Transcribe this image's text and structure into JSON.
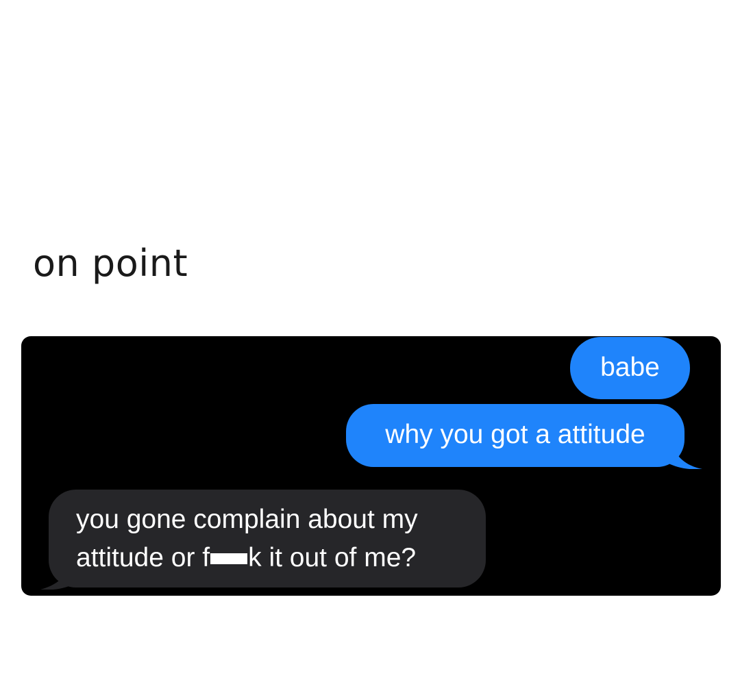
{
  "caption": "on point",
  "chat": {
    "colors": {
      "background": "#000000",
      "sent_bubble": "#1f84fb",
      "received_bubble": "#262629",
      "text": "#ffffff"
    },
    "messages": [
      {
        "direction": "sent",
        "text": "babe"
      },
      {
        "direction": "sent",
        "text": "why you got a attitude"
      },
      {
        "direction": "received",
        "line1": "you gone complain about my",
        "line2_before": "attitude or f",
        "line2_after": "k it out of me?"
      }
    ]
  }
}
